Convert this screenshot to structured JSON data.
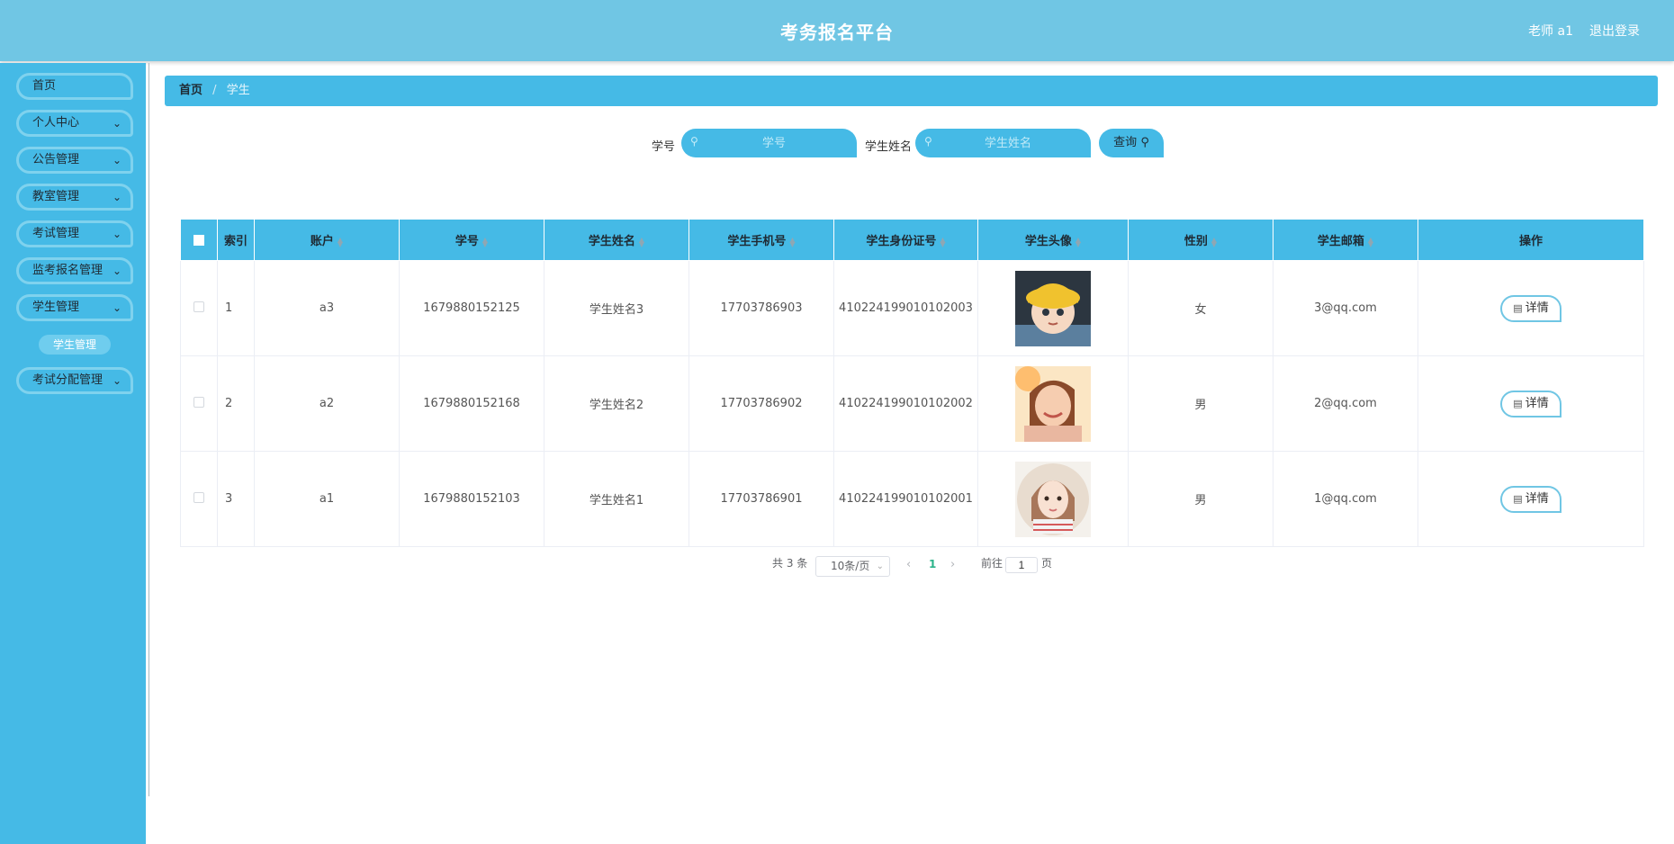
{
  "header": {
    "title": "考务报名平台",
    "user": "老师 a1",
    "logout": "退出登录"
  },
  "sidebar": {
    "items": [
      {
        "label": "首页",
        "has_children": false
      },
      {
        "label": "个人中心",
        "has_children": true
      },
      {
        "label": "公告管理",
        "has_children": true
      },
      {
        "label": "教室管理",
        "has_children": true
      },
      {
        "label": "考试管理",
        "has_children": true
      },
      {
        "label": "监考报名管理",
        "has_children": true
      },
      {
        "label": "学生管理",
        "has_children": true
      },
      {
        "label": "考试分配管理",
        "has_children": true
      }
    ],
    "submenu": "学生管理"
  },
  "breadcrumb": {
    "home": "首页",
    "separator": "/",
    "current": "学生"
  },
  "search": {
    "id_label": "学号",
    "id_placeholder": "学号",
    "name_label": "学生姓名",
    "name_placeholder": "学生姓名",
    "button": "查询"
  },
  "table": {
    "headers": [
      "索引",
      "账户",
      "学号",
      "学生姓名",
      "学生手机号",
      "学生身份证号",
      "学生头像",
      "性别",
      "学生邮箱",
      "操作"
    ],
    "rows": [
      {
        "index": "1",
        "account": "a3",
        "student_id": "1679880152125",
        "name": "学生姓名3",
        "phone": "17703786903",
        "id_card": "410224199010102003",
        "avatar": "cartoon-girl-yellow-hat",
        "gender": "女",
        "email": "3@qq.com",
        "action": "详情"
      },
      {
        "index": "2",
        "account": "a2",
        "student_id": "1679880152168",
        "name": "学生姓名2",
        "phone": "17703786902",
        "id_card": "410224199010102002",
        "avatar": "smiling-girl-photo",
        "gender": "男",
        "email": "2@qq.com",
        "action": "详情"
      },
      {
        "index": "3",
        "account": "a1",
        "student_id": "1679880152103",
        "name": "学生姓名1",
        "phone": "17703786901",
        "id_card": "410224199010102001",
        "avatar": "illustrated-girl-portrait",
        "gender": "男",
        "email": "1@qq.com",
        "action": "详情"
      }
    ]
  },
  "pagination": {
    "total": "共 3 条",
    "page_size": "10条/页",
    "current_page": "1",
    "goto_label": "前往",
    "goto_value": "1",
    "page_suffix": "页"
  },
  "colors": {
    "header": "#70c6e4",
    "primary": "#45bae6",
    "accent": "#2bb38a"
  }
}
